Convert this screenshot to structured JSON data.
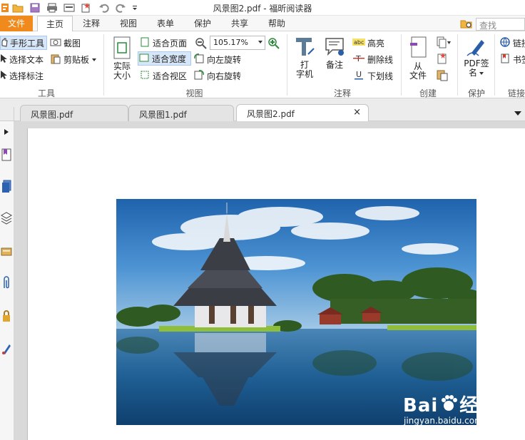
{
  "window": {
    "title": "风景图2.pdf - 福昕阅读器"
  },
  "quick_access": {
    "icons": [
      "app-logo-icon",
      "open-folder-icon",
      "save-icon",
      "print-icon",
      "scan-icon",
      "new-icon",
      "undo-icon",
      "redo-icon",
      "customize-icon"
    ]
  },
  "menu": {
    "items": [
      "文件",
      "主页",
      "注释",
      "视图",
      "表单",
      "保护",
      "共享",
      "帮助"
    ],
    "active": "主页"
  },
  "search": {
    "placeholder": "查找"
  },
  "ribbon": {
    "tools": {
      "hand": "手形工具",
      "select_text": "选择文本",
      "select_annot": "选择标注",
      "snapshot": "截图",
      "clipboard": "剪贴板",
      "label": "工具"
    },
    "view": {
      "actual_size_l1": "实际",
      "actual_size_l2": "大小",
      "fit_page": "适合页面",
      "fit_width": "适合宽度",
      "fit_visible": "适合视区",
      "zoom": "105.17%",
      "rotate_left": "向左旋转",
      "rotate_right": "向右旋转",
      "label": "视图"
    },
    "comment": {
      "typewriter_l1": "打",
      "typewriter_l2": "字机",
      "note": "备注",
      "highlight": "高亮",
      "strikeout": "删除线",
      "underline": "下划线",
      "label": "注释"
    },
    "create": {
      "from_file_l1": "从",
      "from_file_l2": "文件",
      "label": "创建"
    },
    "protect": {
      "pdf_sign_l1": "PDF签",
      "pdf_sign_l2": "名",
      "label": "保护"
    },
    "links": {
      "link": "链接",
      "bookmark": "书签",
      "label": "链接"
    }
  },
  "tabs": [
    {
      "label": "风景图.pdf"
    },
    {
      "label": "风景图1.pdf"
    },
    {
      "label": "风景图2.pdf",
      "active": true
    }
  ],
  "tab_close": "×",
  "watermark": {
    "brand_left": "Bai",
    "brand_right": "经验",
    "url": "jingyan.baidu.com"
  },
  "colors": {
    "accent": "#f08a1c",
    "selection": "#d8e7f8",
    "sky": "#3d86c9",
    "water": "#1f5f94"
  }
}
